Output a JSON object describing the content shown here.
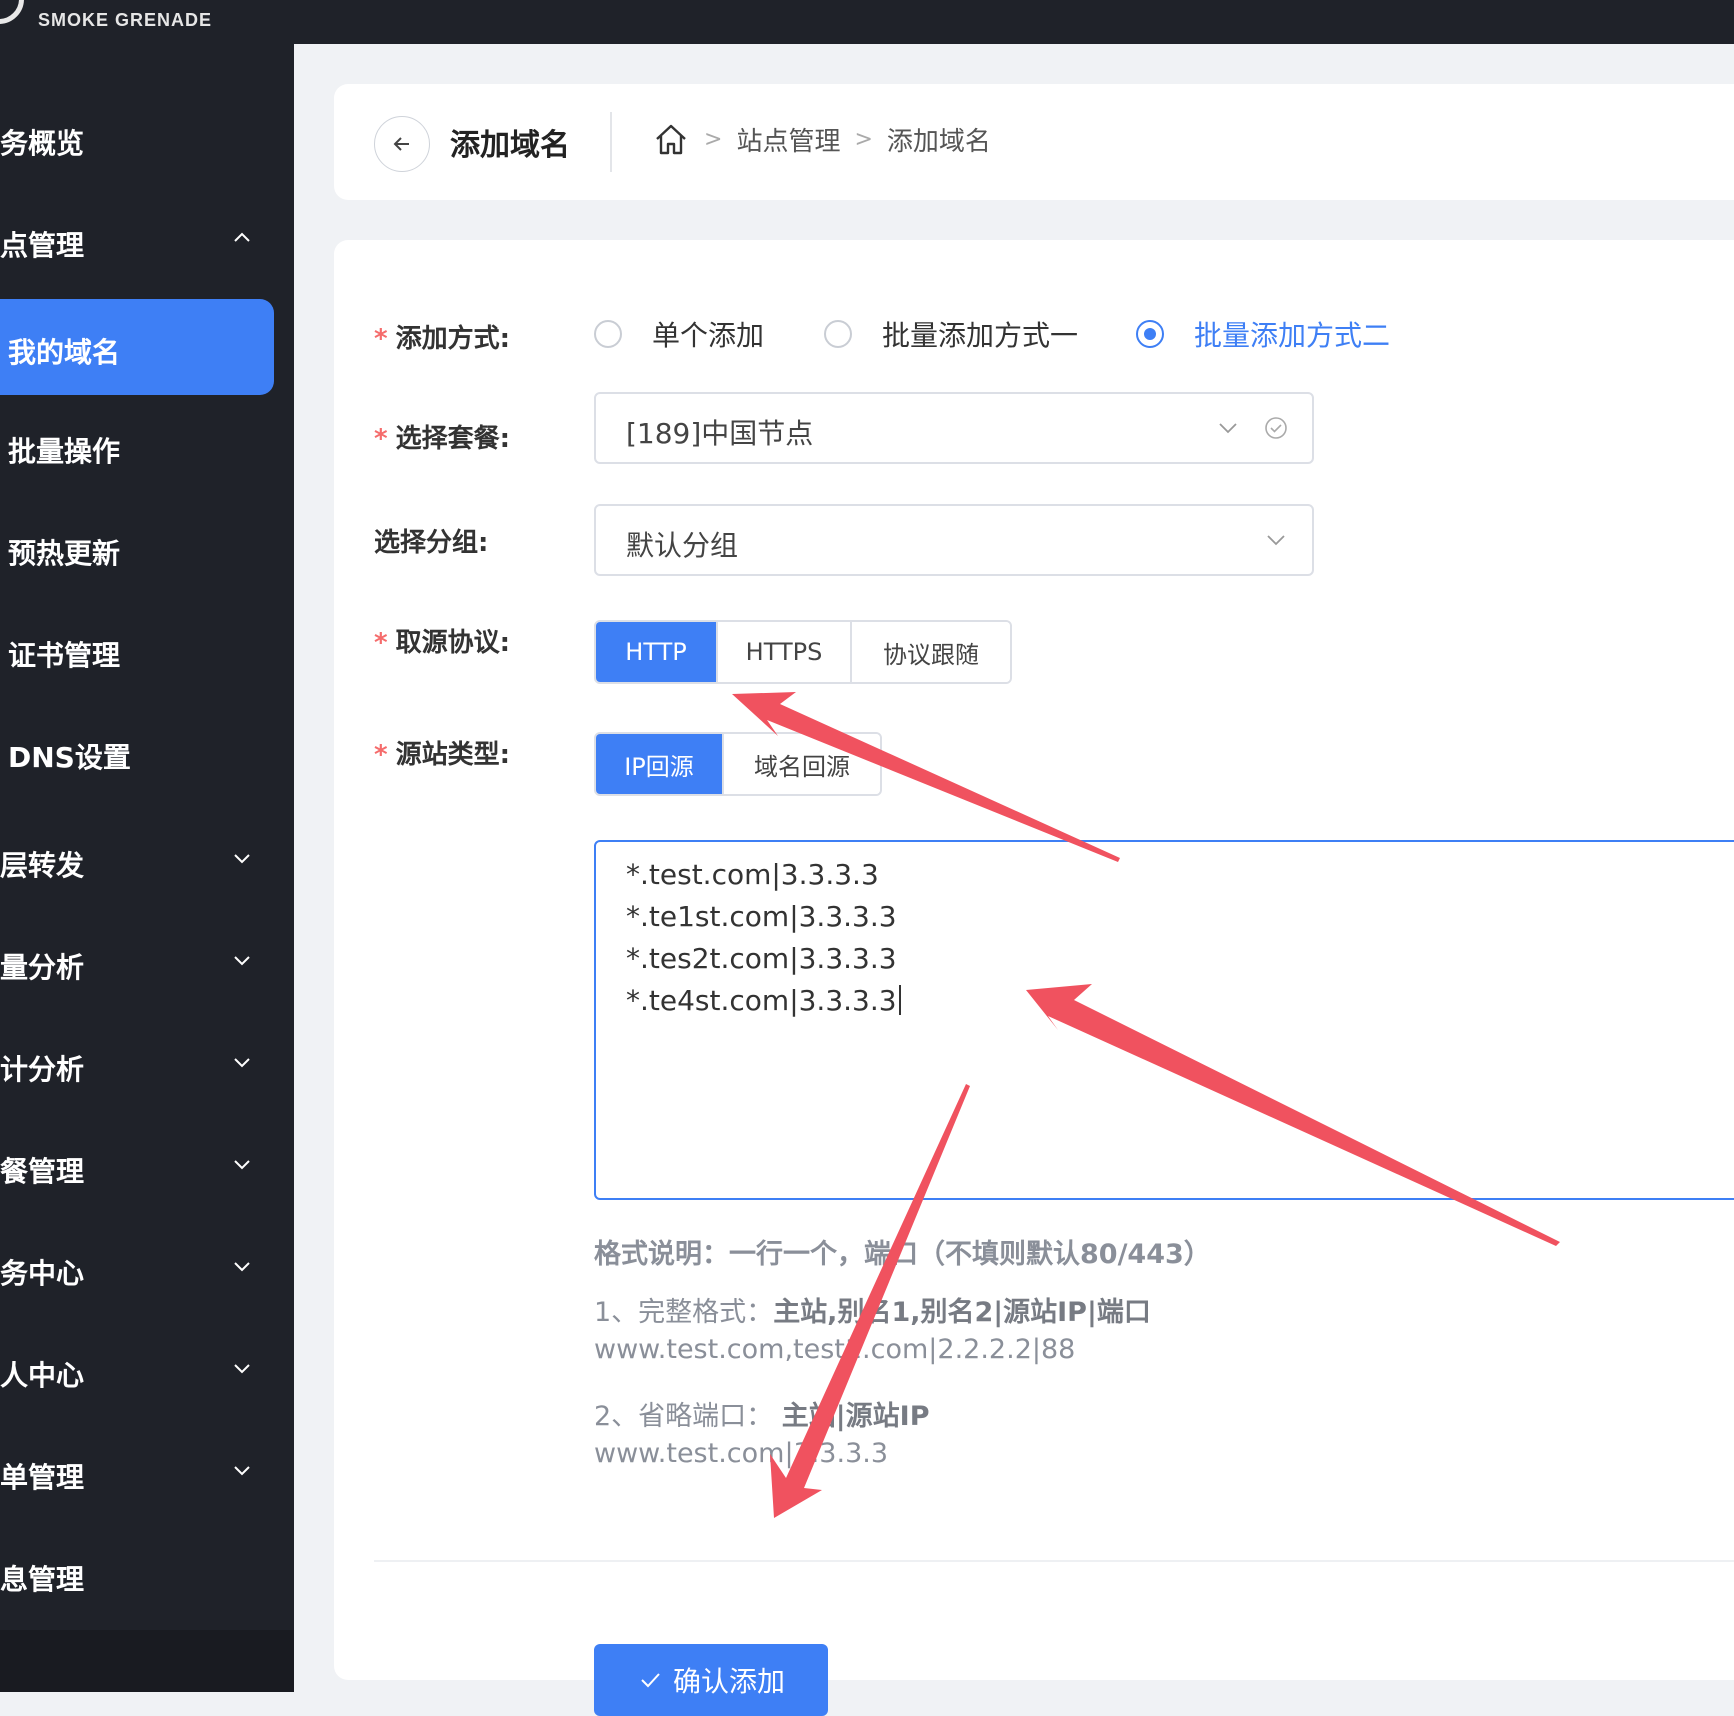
{
  "brand": {
    "name": "SMOKE GRENADE"
  },
  "sidebar": {
    "items": [
      {
        "label": "务概览",
        "expandable": false,
        "active": false
      },
      {
        "label": "点管理",
        "expandable": true,
        "expanded": true,
        "active": false
      },
      {
        "label": "我的域名",
        "expandable": false,
        "active": true
      },
      {
        "label": "批量操作",
        "expandable": false,
        "active": false
      },
      {
        "label": "预热更新",
        "expandable": false,
        "active": false
      },
      {
        "label": "证书管理",
        "expandable": false,
        "active": false
      },
      {
        "label": "DNS设置",
        "expandable": false,
        "active": false
      },
      {
        "label": "层转发",
        "expandable": true,
        "active": false
      },
      {
        "label": "量分析",
        "expandable": true,
        "active": false
      },
      {
        "label": "计分析",
        "expandable": true,
        "active": false
      },
      {
        "label": "餐管理",
        "expandable": true,
        "active": false
      },
      {
        "label": "务中心",
        "expandable": true,
        "active": false
      },
      {
        "label": "人中心",
        "expandable": true,
        "active": false
      },
      {
        "label": "单管理",
        "expandable": true,
        "active": false
      },
      {
        "label": "息管理",
        "expandable": false,
        "active": false
      }
    ]
  },
  "header": {
    "title": "添加域名",
    "breadcrumb": [
      "站点管理",
      "添加域名"
    ]
  },
  "form": {
    "add_method": {
      "label": "添加方式:",
      "required": true,
      "options": [
        "单个添加",
        "批量添加方式一",
        "批量添加方式二"
      ],
      "selected": "批量添加方式二"
    },
    "package": {
      "label": "选择套餐:",
      "required": true,
      "value": "[189]中国节点"
    },
    "group": {
      "label": "选择分组:",
      "required": false,
      "value": "默认分组"
    },
    "protocol": {
      "label": "取源协议:",
      "required": true,
      "options": [
        "HTTP",
        "HTTPS",
        "协议跟随"
      ],
      "selected": "HTTP"
    },
    "origin_type": {
      "label": "源站类型:",
      "required": true,
      "options": [
        "IP回源",
        "域名回源"
      ],
      "selected": "IP回源"
    },
    "domains": {
      "lines": [
        "*.test.com|3.3.3.3",
        "*.te1st.com|3.3.3.3",
        "*.tes2t.com|3.3.3.3",
        "*.te4st.com|3.3.3.3"
      ]
    },
    "help": {
      "title": "格式说明：一行一个，端口（不填则默认80/443）",
      "rule1_prefix": "1、完整格式：",
      "rule1_format": "主站,别名1,别名2|源站IP|端口",
      "rule1_example": "www.test.com,test1.com|2.2.2.2|88",
      "rule2_prefix": "2、省略端口：",
      "rule2_format": "主站|源站IP",
      "rule2_example": "www.test.com|3.3.3.3"
    },
    "submit_label": "确认添加"
  },
  "colors": {
    "accent": "#3e7ff5",
    "sidebar_bg": "#1f2229",
    "required": "#f56c6c",
    "annotation_arrow": "#f0525f"
  }
}
